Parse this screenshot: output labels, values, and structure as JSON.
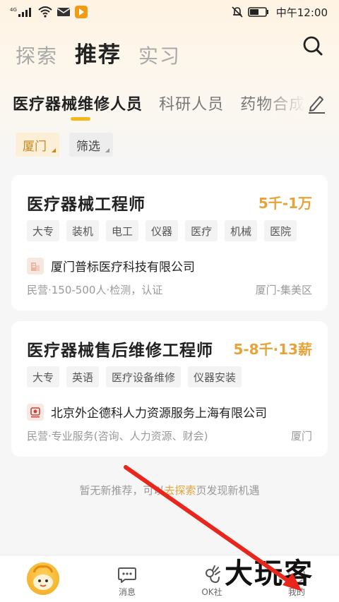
{
  "status_bar": {
    "network": "4G",
    "time": "中午12:00",
    "icons": [
      "signal-icon",
      "wifi-icon",
      "mail-icon",
      "media-icon",
      "mute-icon",
      "battery-icon"
    ]
  },
  "top_tabs": [
    {
      "label": "探索",
      "active": false
    },
    {
      "label": "推荐",
      "active": true
    },
    {
      "label": "实习",
      "active": false
    }
  ],
  "categories": [
    {
      "label": "医疗器械维修人员",
      "active": true
    },
    {
      "label": "科研人员",
      "active": false
    },
    {
      "label": "药物合成",
      "active": false
    }
  ],
  "filters": {
    "city": "厦门",
    "filter": "筛选"
  },
  "jobs": [
    {
      "title": "医疗器械工程师",
      "salary": "5千-1万",
      "tags": [
        "大专",
        "装机",
        "电工",
        "仪器",
        "医疗",
        "机械",
        "医院"
      ],
      "company": "厦门普标医疗科技有限公司",
      "meta": "民营·150-500人·检测，认证",
      "location": "厦门-集美区"
    },
    {
      "title": "医疗器械售后维修工程师",
      "salary": "5-8千·13薪",
      "tags": [
        "大专",
        "英语",
        "医疗设备维修",
        "仪器安装"
      ],
      "company": "北京外企德科人力资源服务上海有限公司",
      "meta": "民营·专业服务(咨询、人力资源、财会)",
      "location": "厦门"
    }
  ],
  "no_more": {
    "prefix": "暂无新推荐，可以",
    "link": "去探索",
    "suffix": "页发现新机遇"
  },
  "bottom_nav": [
    {
      "label": "",
      "icon": "mascot-icon"
    },
    {
      "label": "消息",
      "icon": "chat-icon"
    },
    {
      "label": "OK社",
      "icon": "ok-hand-icon"
    },
    {
      "label": "我的",
      "icon": "profile-icon"
    }
  ],
  "watermark": "大玩客",
  "colors": {
    "accent": "#e5a43a",
    "underline": "#f5b817",
    "arrow": "#e8261c"
  }
}
